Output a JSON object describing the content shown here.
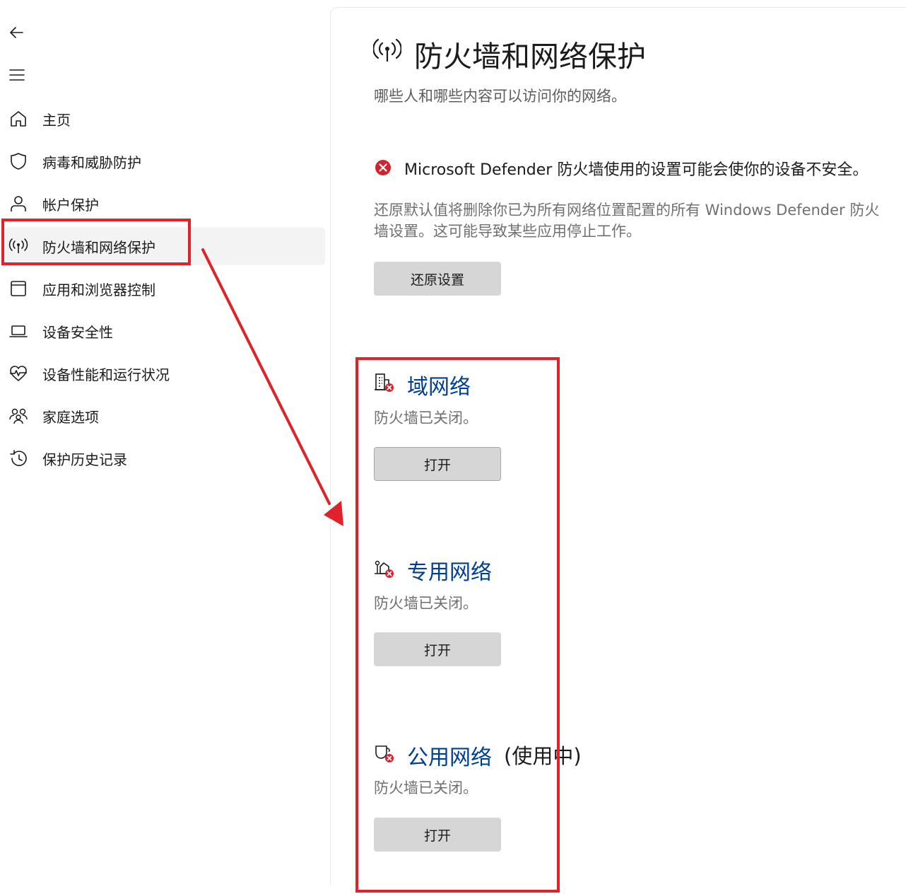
{
  "sidebar": {
    "back_icon": "arrow-left-icon",
    "menu_icon": "hamburger-icon",
    "items": [
      {
        "label": "主页",
        "icon": "home-icon"
      },
      {
        "label": "病毒和威胁防护",
        "icon": "shield-icon"
      },
      {
        "label": "帐户保护",
        "icon": "person-icon"
      },
      {
        "label": "防火墙和网络保护",
        "icon": "wireless-antenna-icon",
        "selected": true
      },
      {
        "label": "应用和浏览器控制",
        "icon": "app-window-icon"
      },
      {
        "label": "设备安全性",
        "icon": "laptop-icon"
      },
      {
        "label": "设备性能和运行状况",
        "icon": "heart-pulse-icon"
      },
      {
        "label": "家庭选项",
        "icon": "family-icon"
      },
      {
        "label": "保护历史记录",
        "icon": "history-icon"
      }
    ]
  },
  "main": {
    "title": "防火墙和网络保护",
    "title_icon": "wireless-antenna-icon",
    "subtitle": "哪些人和哪些内容可以访问你的网络。",
    "warning": {
      "icon": "error-circle-icon",
      "text": "Microsoft Defender 防火墙使用的设置可能会使你的设备不安全。"
    },
    "description": "还原默认值将删除你已为所有网络位置配置的所有 Windows Defender 防火墙设置。这可能导致某些应用停止工作。",
    "restore_button": "还原设置",
    "networks": [
      {
        "name": "域网络",
        "suffix": "",
        "status": "防火墙已关闭。",
        "button": "打开",
        "icon": "domain-network-icon"
      },
      {
        "name": "专用网络",
        "suffix": "",
        "status": "防火墙已关闭。",
        "button": "打开",
        "icon": "private-network-icon"
      },
      {
        "name": "公用网络",
        "suffix": "(使用中)",
        "status": "防火墙已关闭。",
        "button": "打开",
        "icon": "public-network-icon"
      }
    ]
  },
  "colors": {
    "annotation_red": "#e0232a",
    "link_blue": "#003e92",
    "error_red": "#d1242f",
    "button_gray": "#d6d6d6",
    "selected_bg": "#f3f3f3"
  }
}
